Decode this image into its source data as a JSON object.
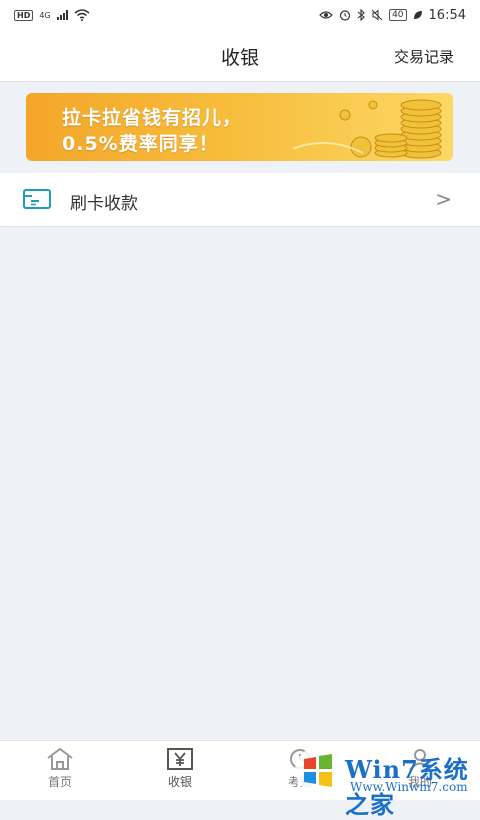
{
  "status_bar": {
    "hd": "HD",
    "network": "4G",
    "time": "16:54",
    "battery": "40"
  },
  "header": {
    "title": "收银",
    "records_link": "交易记录"
  },
  "banner": {
    "line1": "拉卡拉省钱有招儿，",
    "line2": "0.5%费率同享！",
    "colors": {
      "start": "#f3a62a",
      "end": "#fbd865"
    }
  },
  "menu": {
    "card_payment_label": "刷卡收款",
    "card_payment_icon": "card-reader-icon",
    "chevron": ">"
  },
  "tabbar": {
    "tabs": [
      {
        "label": "首页",
        "icon": "home-icon"
      },
      {
        "label": "收银",
        "icon": "yen-cash-register-icon",
        "active": true
      },
      {
        "label": "考勤",
        "icon": "clock-icon"
      },
      {
        "label": "我的",
        "icon": "user-icon"
      }
    ]
  },
  "watermark": {
    "text": "Win7系统之家",
    "url": "Www.Winwin7.com"
  },
  "colors": {
    "accent": "#1aa0b8",
    "background": "#eef1f5"
  }
}
